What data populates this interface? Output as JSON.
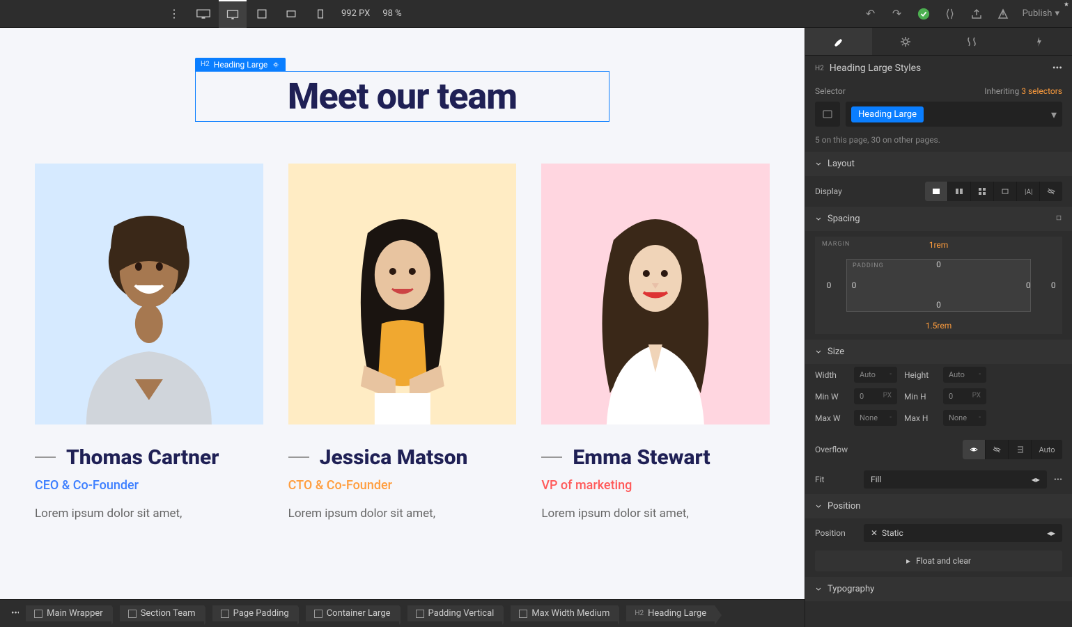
{
  "topbar": {
    "widthValue": "992",
    "widthUnit": "PX",
    "zoom": "98 %",
    "publish": "Publish"
  },
  "canvas": {
    "selTag": "Heading Large",
    "selPrefix": "H2",
    "heading": "Meet our team",
    "team": [
      {
        "name": "Thomas Cartner",
        "role": "CEO & Co-Founder",
        "desc": "Lorem ipsum dolor sit amet,"
      },
      {
        "name": "Jessica Matson",
        "role": "CTO & Co-Founder",
        "desc": "Lorem ipsum dolor sit amet,"
      },
      {
        "name": "Emma Stewart",
        "role": "VP of marketing",
        "desc": "Lorem ipsum dolor sit amet,"
      }
    ]
  },
  "breadcrumb": [
    "Main Wrapper",
    "Section Team",
    "Page Padding",
    "Container Large",
    "Padding Vertical",
    "Max Width Medium",
    "Heading Large"
  ],
  "breadcrumbLast": {
    "prefix": "H2",
    "label": "Heading Large"
  },
  "panel": {
    "headerPrefix": "H2",
    "headerTitle": "Heading Large Styles",
    "selectorLabel": "Selector",
    "inheritingLabel": "Inheriting",
    "inheritingCount": "3 selectors",
    "chip": "Heading Large",
    "count": "5 on this page, 30 on other pages.",
    "layout": {
      "title": "Layout",
      "display": "Display"
    },
    "spacing": {
      "title": "Spacing",
      "margin": "MARGIN",
      "padding": "PADDING",
      "mt": "1rem",
      "mb": "1.5rem",
      "ml": "0",
      "mr": "0",
      "pt": "0",
      "pb": "0",
      "pl": "0",
      "pr": "0"
    },
    "size": {
      "title": "Size",
      "width": "Width",
      "height": "Height",
      "minw": "Min W",
      "minh": "Min H",
      "maxw": "Max W",
      "maxh": "Max H",
      "auto": "Auto",
      "none": "None",
      "zero": "0",
      "px": "PX",
      "dash": "-",
      "overflow": "Overflow",
      "overflowAuto": "Auto",
      "fit": "Fit",
      "fitVal": "Fill"
    },
    "position": {
      "title": "Position",
      "label": "Position",
      "value": "Static",
      "float": "Float and clear"
    },
    "typography": {
      "title": "Typography"
    }
  }
}
